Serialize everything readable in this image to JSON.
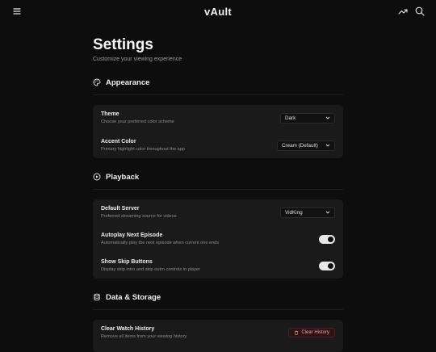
{
  "app": {
    "brand": "vAult"
  },
  "header": {
    "menu_icon": "menu-icon",
    "trending_icon": "trending-icon",
    "search_icon": "search-icon"
  },
  "page": {
    "title": "Settings",
    "subtitle": "Customize your viewing experience"
  },
  "sections": {
    "appearance": {
      "title": "Appearance",
      "icon": "palette-icon",
      "theme": {
        "label": "Theme",
        "description": "Choose your preferred color scheme",
        "value": "Dark"
      },
      "accent": {
        "label": "Accent Color",
        "description": "Primary highlight color throughout the app",
        "value": "Cream (Default)"
      }
    },
    "playback": {
      "title": "Playback",
      "icon": "play-circle-icon",
      "server": {
        "label": "Default Server",
        "description": "Preferred streaming source for videos",
        "value": "VidKing"
      },
      "autoplay": {
        "label": "Autoplay Next Episode",
        "description": "Automatically play the next episode when current one ends",
        "enabled": true
      },
      "skip": {
        "label": "Show Skip Buttons",
        "description": "Display skip intro and skip outro controls in player",
        "enabled": true
      }
    },
    "storage": {
      "title": "Data & Storage",
      "icon": "database-icon",
      "history": {
        "label": "Clear Watch History",
        "description": "Remove all items from your viewing history",
        "button": "Clear History"
      }
    }
  },
  "colors": {
    "background": "#0d0d0d",
    "card": "#1a1a1a",
    "danger": "#f0a0a0",
    "toggle_on": "#e8e8e8"
  }
}
